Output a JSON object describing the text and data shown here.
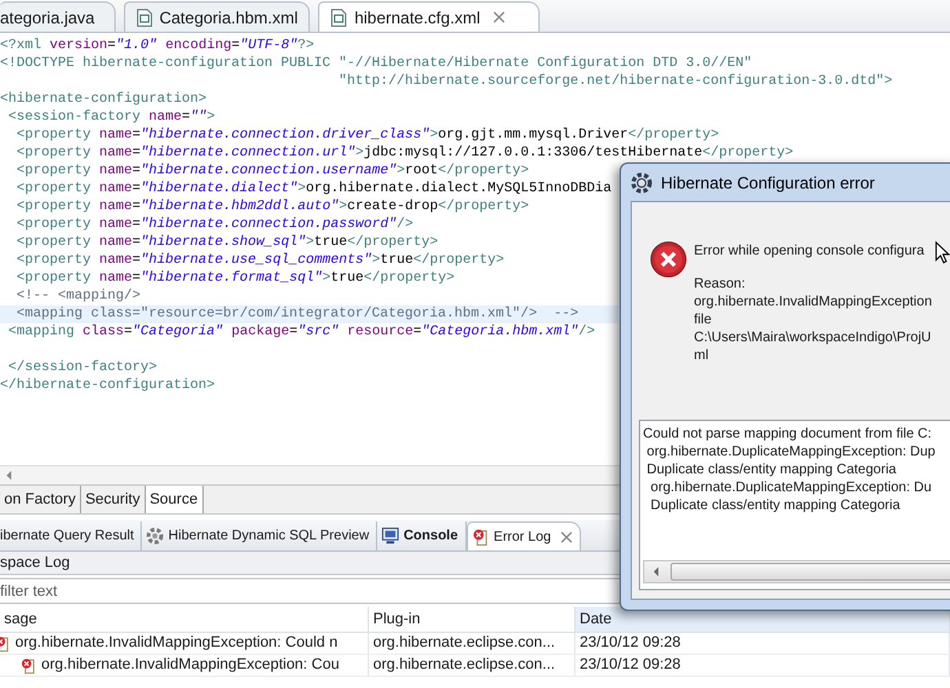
{
  "editor_tabs": [
    {
      "label": "ategoria.java",
      "selected": false
    },
    {
      "label": "Categoria.hbm.xml",
      "selected": false
    },
    {
      "label": "hibernate.cfg.xml",
      "selected": true
    }
  ],
  "code_lines": [
    {
      "highlighted": false,
      "segments": [
        {
          "kind": "tag",
          "text": "<?xml"
        },
        {
          "kind": "attr",
          "text": " version"
        },
        {
          "kind": "text",
          "text": "="
        },
        {
          "kind": "value",
          "text": "\"1.0\""
        },
        {
          "kind": "attr",
          "text": " encoding"
        },
        {
          "kind": "text",
          "text": "="
        },
        {
          "kind": "value",
          "text": "\"UTF-8\""
        },
        {
          "kind": "tag",
          "text": "?>"
        }
      ]
    },
    {
      "highlighted": false,
      "segments": [
        {
          "kind": "tag",
          "text": "<!DOCTYPE hibernate-configuration PUBLIC "
        },
        {
          "kind": "dtd",
          "text": "\"-//Hibernate/Hibernate Configuration DTD 3.0//EN\""
        }
      ]
    },
    {
      "highlighted": false,
      "segments": [
        {
          "kind": "dtd",
          "text": "                                         \"http://hibernate.sourceforge.net/hibernate-configuration-3.0.dtd\""
        },
        {
          "kind": "tag",
          "text": ">"
        }
      ]
    },
    {
      "highlighted": false,
      "segments": [
        {
          "kind": "tag",
          "text": "<hibernate-configuration>"
        }
      ]
    },
    {
      "highlighted": false,
      "segments": [
        {
          "kind": "tag",
          "text": " <session-factory"
        },
        {
          "kind": "attr",
          "text": " name"
        },
        {
          "kind": "text",
          "text": "="
        },
        {
          "kind": "value",
          "text": "\"\""
        },
        {
          "kind": "tag",
          "text": ">"
        }
      ]
    },
    {
      "highlighted": false,
      "segments": [
        {
          "kind": "tag",
          "text": "  <property"
        },
        {
          "kind": "attr",
          "text": " name"
        },
        {
          "kind": "text",
          "text": "="
        },
        {
          "kind": "value",
          "text": "\"hibernate.connection.driver_class\""
        },
        {
          "kind": "tag",
          "text": ">"
        },
        {
          "kind": "text",
          "text": "org.gjt.mm.mysql.Driver"
        },
        {
          "kind": "tag",
          "text": "</property>"
        }
      ]
    },
    {
      "highlighted": false,
      "segments": [
        {
          "kind": "tag",
          "text": "  <property"
        },
        {
          "kind": "attr",
          "text": " name"
        },
        {
          "kind": "text",
          "text": "="
        },
        {
          "kind": "value",
          "text": "\"hibernate.connection.url\""
        },
        {
          "kind": "tag",
          "text": ">"
        },
        {
          "kind": "text",
          "text": "jdbc:mysql://127.0.0.1:3306/testHibernate"
        },
        {
          "kind": "tag",
          "text": "</property>"
        }
      ]
    },
    {
      "highlighted": false,
      "segments": [
        {
          "kind": "tag",
          "text": "  <property"
        },
        {
          "kind": "attr",
          "text": " name"
        },
        {
          "kind": "text",
          "text": "="
        },
        {
          "kind": "value",
          "text": "\"hibernate.connection.username\""
        },
        {
          "kind": "tag",
          "text": ">"
        },
        {
          "kind": "text",
          "text": "root"
        },
        {
          "kind": "tag",
          "text": "</property>"
        }
      ]
    },
    {
      "highlighted": false,
      "segments": [
        {
          "kind": "tag",
          "text": "  <property"
        },
        {
          "kind": "attr",
          "text": " name"
        },
        {
          "kind": "text",
          "text": "="
        },
        {
          "kind": "value",
          "text": "\"hibernate.dialect\""
        },
        {
          "kind": "tag",
          "text": ">"
        },
        {
          "kind": "text",
          "text": "org.hibernate.dialect.MySQL5InnoDBDia"
        }
      ]
    },
    {
      "highlighted": false,
      "segments": [
        {
          "kind": "tag",
          "text": "  <property"
        },
        {
          "kind": "attr",
          "text": " name"
        },
        {
          "kind": "text",
          "text": "="
        },
        {
          "kind": "value",
          "text": "\"hibernate.hbm2ddl.auto\""
        },
        {
          "kind": "tag",
          "text": ">"
        },
        {
          "kind": "text",
          "text": "create-drop"
        },
        {
          "kind": "tag",
          "text": "</property>"
        }
      ]
    },
    {
      "highlighted": false,
      "segments": [
        {
          "kind": "tag",
          "text": "  <property"
        },
        {
          "kind": "attr",
          "text": " name"
        },
        {
          "kind": "text",
          "text": "="
        },
        {
          "kind": "value",
          "text": "\"hibernate.connection.password\""
        },
        {
          "kind": "tag",
          "text": "/>"
        }
      ]
    },
    {
      "highlighted": false,
      "segments": [
        {
          "kind": "tag",
          "text": "  <property"
        },
        {
          "kind": "attr",
          "text": " name"
        },
        {
          "kind": "text",
          "text": "="
        },
        {
          "kind": "value",
          "text": "\"hibernate.show_sql\""
        },
        {
          "kind": "tag",
          "text": ">"
        },
        {
          "kind": "text",
          "text": "true"
        },
        {
          "kind": "tag",
          "text": "</property>"
        }
      ]
    },
    {
      "highlighted": false,
      "segments": [
        {
          "kind": "tag",
          "text": "  <property"
        },
        {
          "kind": "attr",
          "text": " name"
        },
        {
          "kind": "text",
          "text": "="
        },
        {
          "kind": "value",
          "text": "\"hibernate.use_sql_comments\""
        },
        {
          "kind": "tag",
          "text": ">"
        },
        {
          "kind": "text",
          "text": "true"
        },
        {
          "kind": "tag",
          "text": "</property>"
        }
      ]
    },
    {
      "highlighted": false,
      "segments": [
        {
          "kind": "tag",
          "text": "  <property"
        },
        {
          "kind": "attr",
          "text": " name"
        },
        {
          "kind": "text",
          "text": "="
        },
        {
          "kind": "value",
          "text": "\"hibernate.format_sql\""
        },
        {
          "kind": "tag",
          "text": ">"
        },
        {
          "kind": "text",
          "text": "true"
        },
        {
          "kind": "tag",
          "text": "</property>"
        }
      ]
    },
    {
      "highlighted": false,
      "segments": [
        {
          "kind": "comment",
          "text": "  <!-- <mapping/>"
        }
      ]
    },
    {
      "highlighted": true,
      "segments": [
        {
          "kind": "comment",
          "text": "  <mapping class=\"resource=br/com/integrator/Categoria.hbm.xml\"/>  -->"
        }
      ]
    },
    {
      "highlighted": false,
      "segments": [
        {
          "kind": "tag",
          "text": " <mapping"
        },
        {
          "kind": "attr",
          "text": " class"
        },
        {
          "kind": "text",
          "text": "="
        },
        {
          "kind": "value",
          "text": "\"Categoria\""
        },
        {
          "kind": "attr",
          "text": " package"
        },
        {
          "kind": "text",
          "text": "="
        },
        {
          "kind": "value",
          "text": "\"src\""
        },
        {
          "kind": "attr",
          "text": " resource"
        },
        {
          "kind": "text",
          "text": "="
        },
        {
          "kind": "value",
          "text": "\"Categoria.hbm.xml\""
        },
        {
          "kind": "tag",
          "text": "/>"
        }
      ]
    },
    {
      "highlighted": false
    },
    {
      "highlighted": false,
      "segments": [
        {
          "kind": "tag",
          "text": " </session-factory>"
        }
      ]
    },
    {
      "highlighted": false,
      "segments": [
        {
          "kind": "tag",
          "text": "</hibernate-configuration>"
        }
      ]
    }
  ],
  "page_tabs": [
    {
      "label": "on Factory",
      "selected": false
    },
    {
      "label": "Security",
      "selected": false
    },
    {
      "label": "Source",
      "selected": true
    }
  ],
  "view_tabs": [
    {
      "label": "ibernate Query Result",
      "selected": false,
      "bold": false
    },
    {
      "label": "Hibernate Dynamic SQL Preview",
      "selected": false,
      "bold": false
    },
    {
      "label": "Console",
      "selected": false,
      "bold": true
    },
    {
      "label": "Error Log",
      "selected": true,
      "bold": false
    }
  ],
  "log_title": "space Log",
  "filter": {
    "placeholder": "filter text"
  },
  "table": {
    "columns": [
      {
        "label": "sage",
        "sorted": false
      },
      {
        "label": "Plug-in",
        "sorted": false
      },
      {
        "label": "Date",
        "sorted": true
      }
    ],
    "rows": [
      {
        "message": "org.hibernate.InvalidMappingException: Could n",
        "plugin": "org.hibernate.eclipse.con...",
        "date": "23/10/12 09:28",
        "children": [
          {
            "message": "org.hibernate.InvalidMappingException: Cou",
            "plugin": "org.hibernate.eclipse.con...",
            "date": "23/10/12 09:28"
          }
        ]
      }
    ]
  },
  "dialog": {
    "title": "Hibernate Configuration error",
    "message": "Error while opening console configura",
    "reason_lines": [
      "Reason:",
      "org.hibernate.InvalidMappingException",
      "file",
      "C:\\Users\\Maira\\workspaceIndigo\\ProjU",
      "ml"
    ],
    "details": [
      "Could not parse mapping document from file C:",
      " org.hibernate.DuplicateMappingException: Dup",
      " Duplicate class/entity mapping Categoria",
      "  org.hibernate.DuplicateMappingException: Du",
      "  Duplicate class/entity mapping Categoria"
    ]
  }
}
